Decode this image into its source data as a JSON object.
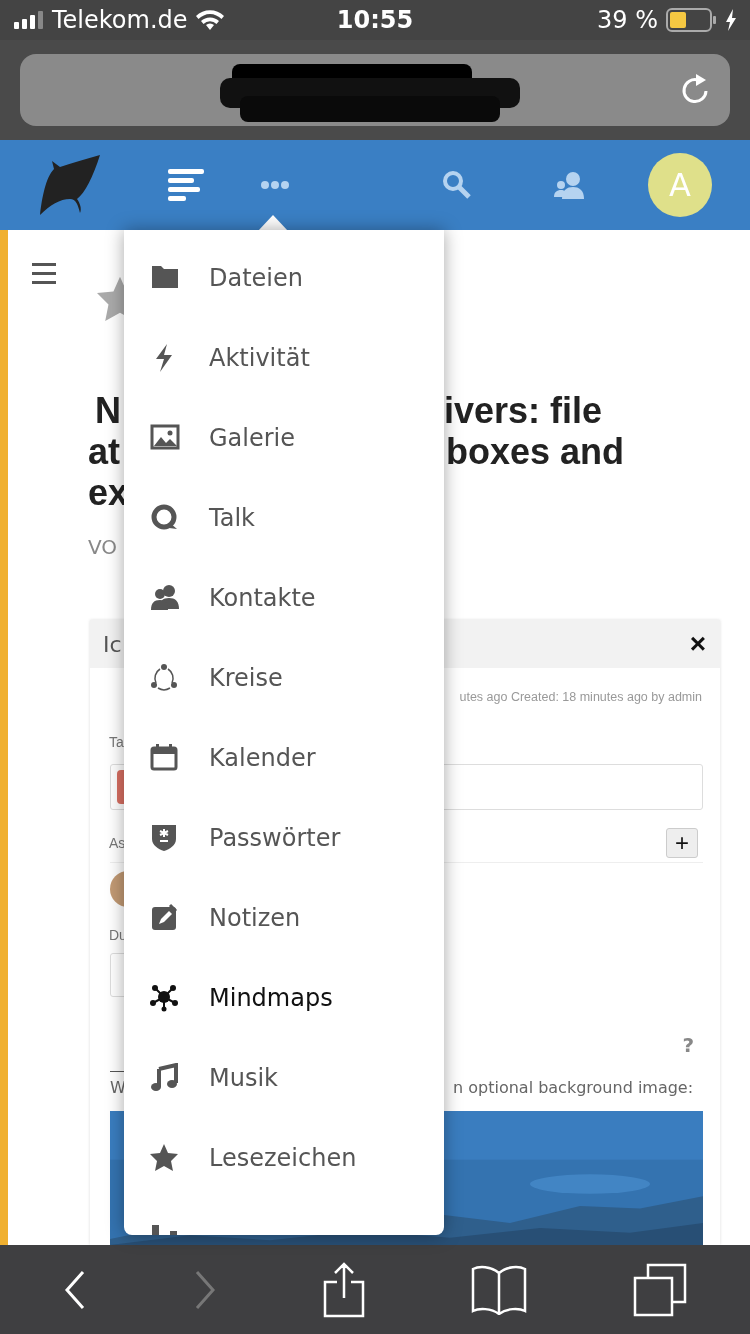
{
  "status_bar": {
    "carrier": "Telekom.de",
    "time": "10:55",
    "battery": "39 %"
  },
  "nav": {
    "avatar_letter": "A"
  },
  "page": {
    "title_left": [
      "N",
      "at",
      "ex"
    ],
    "title_right": [
      "ivers: file",
      "boxes and"
    ],
    "byline": "VO",
    "card": {
      "title": "Ic",
      "close": "×",
      "meta": "utes ago Created: 18 minutes ago by admin",
      "labels": [
        "Ta",
        "As",
        "Du"
      ],
      "add": "+",
      "help": "?",
      "note_start": "W",
      "note_end": "n optional background image:"
    }
  },
  "menu": {
    "items": [
      {
        "label": "Dateien",
        "selected": false
      },
      {
        "label": "Aktivität",
        "selected": false
      },
      {
        "label": "Galerie",
        "selected": false
      },
      {
        "label": "Talk",
        "selected": false
      },
      {
        "label": "Kontakte",
        "selected": false
      },
      {
        "label": "Kreise",
        "selected": false
      },
      {
        "label": "Kalender",
        "selected": false
      },
      {
        "label": "Passwörter",
        "selected": false
      },
      {
        "label": "Notizen",
        "selected": false
      },
      {
        "label": "Mindmaps",
        "selected": true
      },
      {
        "label": "Musik",
        "selected": false
      },
      {
        "label": "Lesezeichen",
        "selected": false
      },
      {
        "selected": false
      }
    ]
  }
}
